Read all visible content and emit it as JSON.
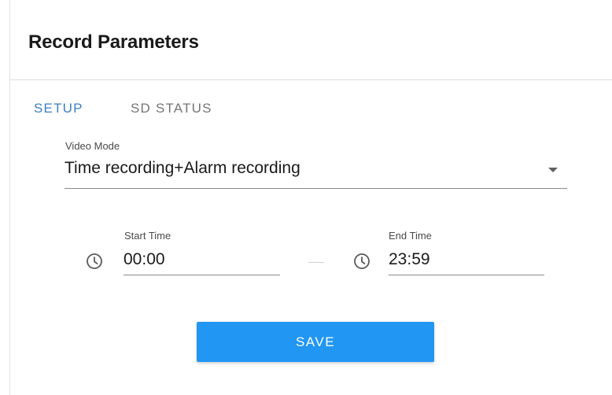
{
  "header": {
    "title": "Record Parameters"
  },
  "tabs": [
    {
      "label": "SETUP",
      "active": true
    },
    {
      "label": "SD STATUS",
      "active": false
    }
  ],
  "video_mode": {
    "label": "Video Mode",
    "value": "Time recording+Alarm recording",
    "icon": "chevron-down-icon"
  },
  "schedule": {
    "start": {
      "label": "Start Time",
      "value": "00:00",
      "icon": "clock-icon"
    },
    "end": {
      "label": "End Time",
      "value": "23:59",
      "icon": "clock-icon"
    }
  },
  "actions": {
    "save_label": "SAVE"
  },
  "colors": {
    "accent": "#2196f3",
    "active_tab": "#3d7fc1",
    "inactive_tab": "#757575"
  }
}
